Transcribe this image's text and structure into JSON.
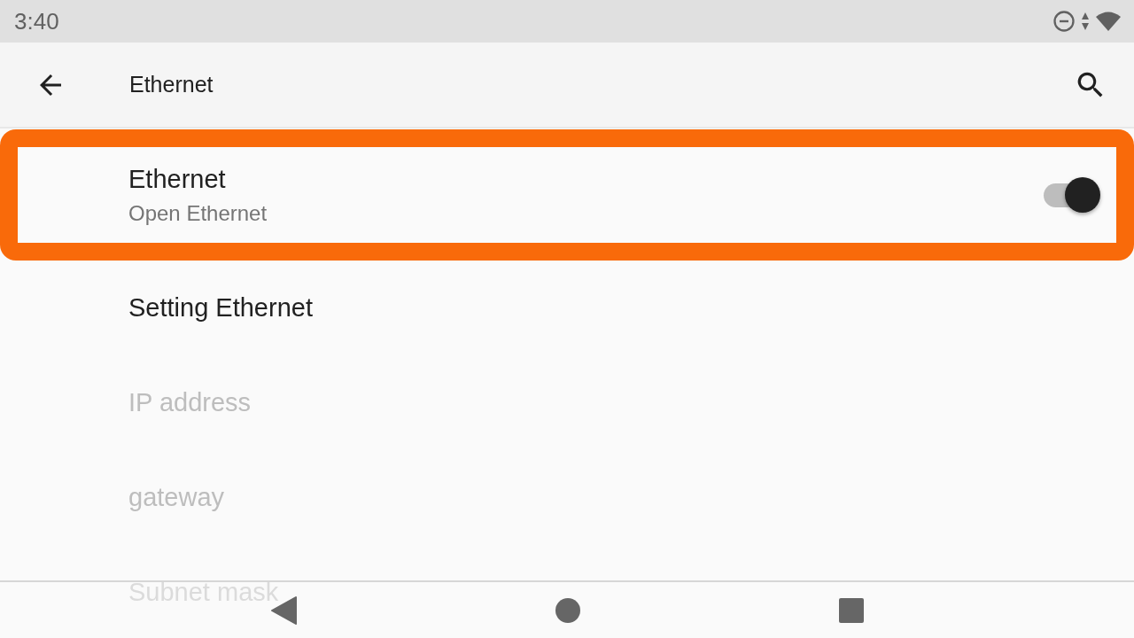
{
  "status_bar": {
    "time": "3:40"
  },
  "app_bar": {
    "title": "Ethernet"
  },
  "items": [
    {
      "kind": "switch",
      "title": "Ethernet",
      "summary": "Open Ethernet",
      "on": true,
      "highlighted": true,
      "disabled": false
    },
    {
      "kind": "plain",
      "title": "Setting Ethernet",
      "disabled": false
    },
    {
      "kind": "plain",
      "title": "IP address",
      "disabled": true
    },
    {
      "kind": "plain",
      "title": "gateway",
      "disabled": true
    },
    {
      "kind": "plain",
      "title": "Subnet mask",
      "disabled": true
    }
  ]
}
